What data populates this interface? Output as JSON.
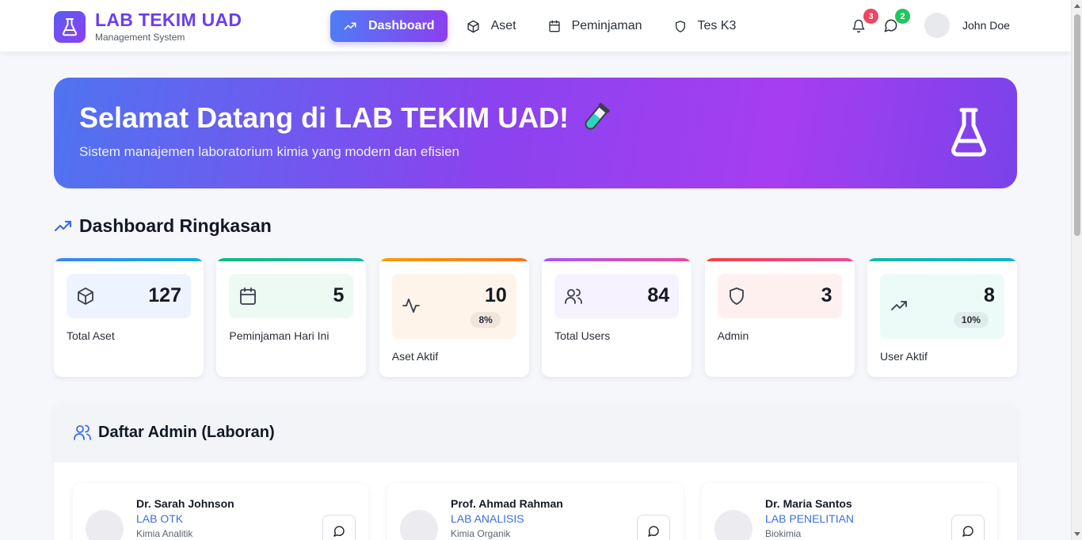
{
  "brand": {
    "title": "LAB TEKIM UAD",
    "subtitle": "Management System"
  },
  "nav": {
    "items": [
      {
        "label": "Dashboard",
        "icon": "trending-up-icon",
        "active": true
      },
      {
        "label": "Aset",
        "icon": "box-icon"
      },
      {
        "label": "Peminjaman",
        "icon": "calendar-icon"
      },
      {
        "label": "Tes K3",
        "icon": "shield-icon"
      }
    ]
  },
  "header": {
    "notifications_count": "3",
    "messages_count": "2",
    "user_name": "John Doe"
  },
  "hero": {
    "title": "Selamat Datang di LAB TEKIM UAD!",
    "subtitle": "Sistem manajemen laboratorium kimia yang modern dan efisien"
  },
  "summary": {
    "title": "Dashboard Ringkasan",
    "cards": [
      {
        "value": "127",
        "label": "Total Aset",
        "icon": "box-icon",
        "bar_color": "#3b82f6",
        "box_color": "#eef4ff"
      },
      {
        "value": "5",
        "label": "Peminjaman Hari Ini",
        "icon": "calendar-icon",
        "bar_color": "#10b981",
        "box_color": "#edfaf3"
      },
      {
        "value": "10",
        "pct": "8%",
        "label": "Aset Aktif",
        "icon": "activity-icon",
        "bar_color": "#f59e0b",
        "box_color": "#fff4ea"
      },
      {
        "value": "84",
        "label": "Total Users",
        "icon": "users-icon",
        "bar_color": "#a855f7",
        "box_color": "#f7f2ff"
      },
      {
        "value": "3",
        "label": "Admin",
        "icon": "shield-icon",
        "bar_color": "#ef4444",
        "box_color": "#fff0f0"
      },
      {
        "value": "8",
        "pct": "10%",
        "label": "User Aktif",
        "icon": "trending-up-icon",
        "bar_color": "#14b8a6",
        "box_color": "#edfbf8"
      }
    ]
  },
  "admins": {
    "title": "Daftar Admin (Laboran)",
    "items": [
      {
        "name": "Dr. Sarah Johnson",
        "lab": "LAB OTK",
        "dept": "Kimia Analitik"
      },
      {
        "name": "Prof. Ahmad Rahman",
        "lab": "LAB ANALISIS",
        "dept": "Kimia Organik"
      },
      {
        "name": "Dr. Maria Santos",
        "lab": "LAB PENELITIAN",
        "dept": "Biokimia"
      }
    ]
  }
}
